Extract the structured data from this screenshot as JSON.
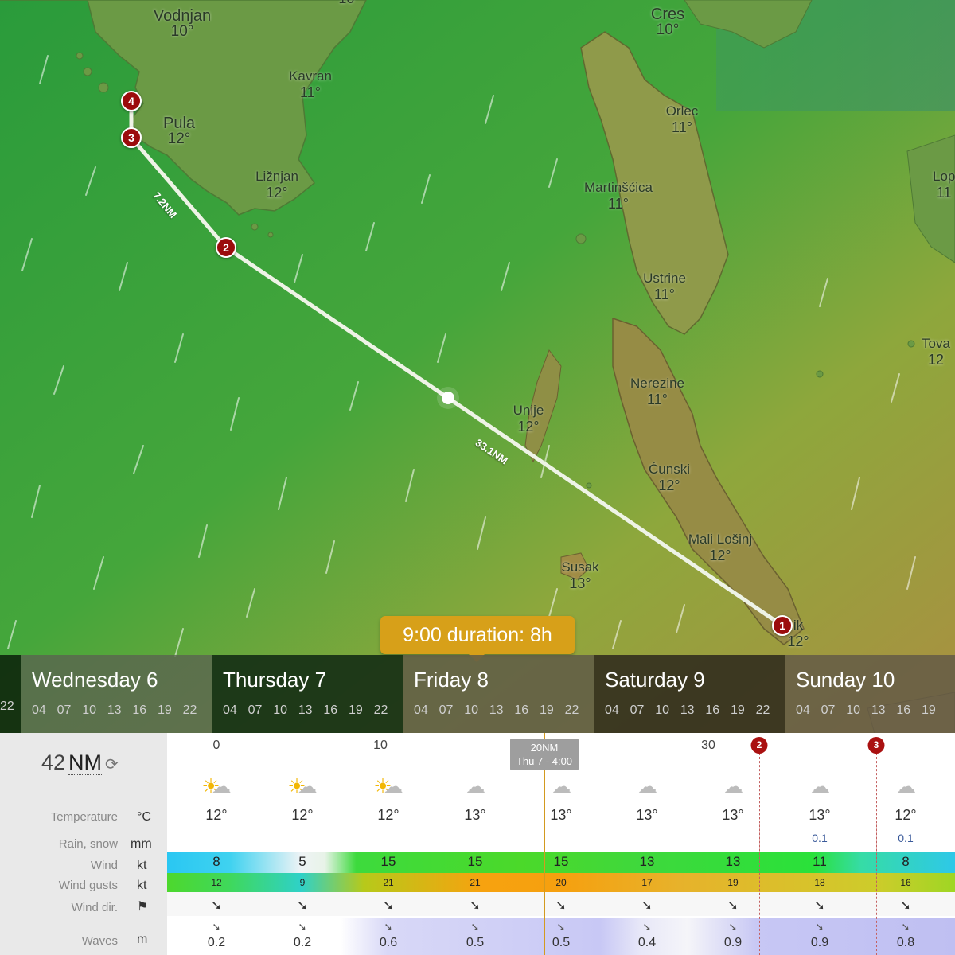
{
  "map": {
    "places": [
      {
        "name": "Vodnjan",
        "temp": "10°"
      },
      {
        "name": "Cres",
        "temp": "10°"
      },
      {
        "name": "Kavran",
        "temp": "11°"
      },
      {
        "name": "Pula",
        "temp": "12°"
      },
      {
        "name": "Orlec",
        "temp": "11°"
      },
      {
        "name": "Ližnjan",
        "temp": "12°"
      },
      {
        "name": "Martinšćica",
        "temp": "11°"
      },
      {
        "name": "Ustrine",
        "temp": "11°"
      },
      {
        "name": "Nerezine",
        "temp": "11°"
      },
      {
        "name": "Unije",
        "temp": "12°"
      },
      {
        "name": "Ćunski",
        "temp": "12°"
      },
      {
        "name": "Mali Lošinj",
        "temp": "12°"
      },
      {
        "name": "Susak",
        "temp": "13°"
      },
      {
        "name": "Lop",
        "temp": "11"
      },
      {
        "name": "Tova",
        "temp": "12"
      },
      {
        "name": "ik",
        "temp": "12°"
      }
    ],
    "top_edge_temp": "10°",
    "route_points": [
      "1",
      "2",
      "3",
      "4"
    ],
    "segments": [
      "7.2NM",
      "33.1NM"
    ],
    "bubble": "9:00 duration: 8h"
  },
  "days": {
    "prev_hour": "22",
    "hours": [
      "04",
      "07",
      "10",
      "13",
      "16",
      "19",
      "22"
    ],
    "list": [
      "Wednesday 6",
      "Thursday 7",
      "Friday 8",
      "Saturday 9",
      "Sunday 10"
    ],
    "last_hours": [
      "04",
      "07",
      "10",
      "13",
      "16",
      "19"
    ]
  },
  "table": {
    "distance": "42",
    "distance_unit": "NM",
    "rows": {
      "temperature": {
        "label": "Temperature",
        "unit": "°C"
      },
      "rain": {
        "label": "Rain, snow",
        "unit": "mm"
      },
      "wind": {
        "label": "Wind",
        "unit": "kt"
      },
      "gusts": {
        "label": "Wind gusts",
        "unit": "kt"
      },
      "dir": {
        "label": "Wind dir.",
        "unit": "⚑"
      },
      "waves": {
        "label": "Waves",
        "unit": "m"
      }
    },
    "scale": [
      "0",
      "10",
      "30"
    ],
    "now_tip": {
      "line1": "20NM",
      "line2": "Thu 7 - 4:00"
    },
    "markers": [
      "2",
      "3"
    ],
    "columns": [
      {
        "wx": "sun-cloud-icon",
        "temp": "12°",
        "rain": "",
        "wind": "8",
        "gust": "12",
        "wave": "0.2"
      },
      {
        "wx": "sun-cloud-icon",
        "temp": "12°",
        "rain": "",
        "wind": "5",
        "gust": "9",
        "wave": "0.2"
      },
      {
        "wx": "sun-cloud-icon",
        "temp": "12°",
        "rain": "",
        "wind": "15",
        "gust": "21",
        "wave": "0.6"
      },
      {
        "wx": "cloud-icon",
        "temp": "13°",
        "rain": "",
        "wind": "15",
        "gust": "21",
        "wave": "0.5"
      },
      {
        "wx": "cloud-icon",
        "temp": "13°",
        "rain": "",
        "wind": "15",
        "gust": "20",
        "wave": "0.5"
      },
      {
        "wx": "cloud-icon",
        "temp": "13°",
        "rain": "",
        "wind": "13",
        "gust": "17",
        "wave": "0.4"
      },
      {
        "wx": "cloud-icon",
        "temp": "13°",
        "rain": "",
        "wind": "13",
        "gust": "19",
        "wave": "0.9"
      },
      {
        "wx": "cloud-icon",
        "temp": "13°",
        "rain": "0.1",
        "wind": "11",
        "gust": "18",
        "wave": "0.9"
      },
      {
        "wx": "cloud-icon",
        "temp": "12°",
        "rain": "0.1",
        "wind": "8",
        "gust": "16",
        "wave": "0.8"
      }
    ]
  }
}
